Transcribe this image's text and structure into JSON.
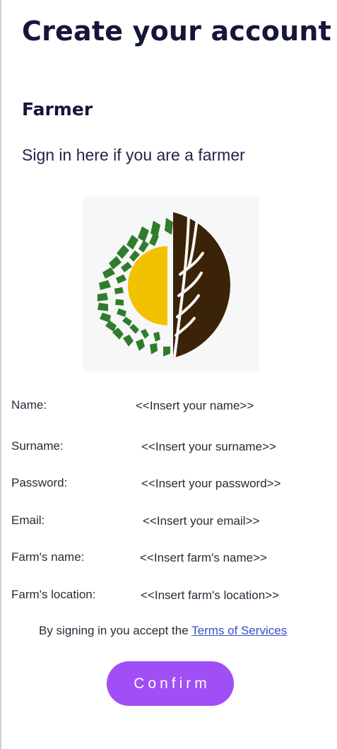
{
  "page": {
    "title": "Create your account",
    "role_title": "Farmer",
    "role_subtitle": "Sign in here if you are a farmer"
  },
  "logo": {
    "icon": "wheat-sun-logo-icon",
    "colors": {
      "green": "#2f7d2c",
      "yellow": "#f2c200",
      "brown": "#3b2308",
      "background": "#f7f7f7"
    }
  },
  "form": {
    "fields": [
      {
        "label": "Name:",
        "placeholder": "<<Insert your name>>"
      },
      {
        "label": "Surname:",
        "placeholder": "<<Insert your surname>>"
      },
      {
        "label": "Password:",
        "placeholder": "<<Insert your password>>"
      },
      {
        "label": "Email:",
        "placeholder": "<<Insert your email>>"
      },
      {
        "label": "Farm's name:",
        "placeholder": "<<Insert farm's name>>"
      },
      {
        "label": "Farm's location:",
        "placeholder": "<<Insert farm's location>>"
      }
    ]
  },
  "terms": {
    "prefix": "By signing in you accept the ",
    "link_text": "Terms of Services"
  },
  "confirm": {
    "label": "Confirm",
    "color": "#a04ef6"
  }
}
